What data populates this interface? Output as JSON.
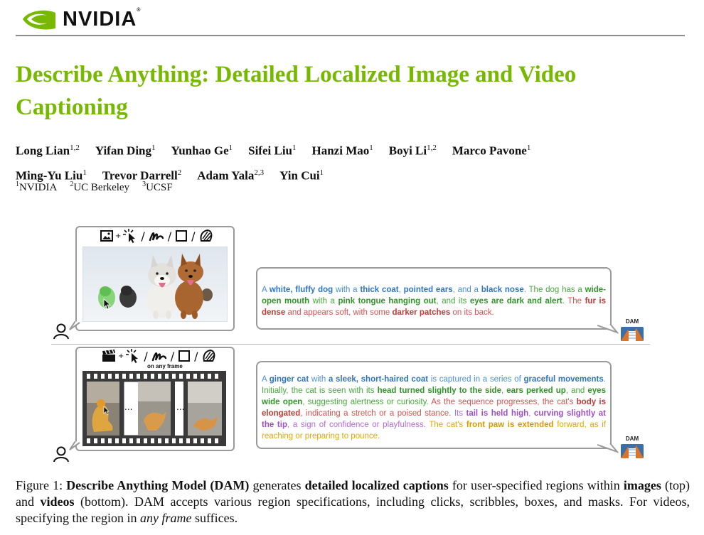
{
  "header": {
    "logo_text": "NVIDIA",
    "logo_mark": "®",
    "brand_color": "#76b900"
  },
  "paper": {
    "title": "Describe Anything: Detailed Localized Image and Video Captioning",
    "authors": [
      {
        "name": "Long Lian",
        "aff": "1,2"
      },
      {
        "name": "Yifan Ding",
        "aff": "1"
      },
      {
        "name": "Yunhao Ge",
        "aff": "1"
      },
      {
        "name": "Sifei Liu",
        "aff": "1"
      },
      {
        "name": "Hanzi Mao",
        "aff": "1"
      },
      {
        "name": "Boyi Li",
        "aff": "1,2"
      },
      {
        "name": "Marco Pavone",
        "aff": "1"
      },
      {
        "name": "Ming-Yu Liu",
        "aff": "1"
      },
      {
        "name": "Trevor Darrell",
        "aff": "2"
      },
      {
        "name": "Adam Yala",
        "aff": "2,3"
      },
      {
        "name": "Yin Cui",
        "aff": "1"
      }
    ],
    "affiliations": [
      {
        "num": "1",
        "name": "NVIDIA"
      },
      {
        "num": "2",
        "name": "UC Berkeley"
      },
      {
        "num": "3",
        "name": "UCSF"
      }
    ]
  },
  "figure": {
    "tool_plus": "+",
    "tool_slash": "/",
    "on_any_frame": "on any frame",
    "ellipsis": "...",
    "dam_label": "DAM",
    "image_caption": [
      {
        "c": "blue",
        "t": "A "
      },
      {
        "c": "blue",
        "b": true,
        "t": "white, fluffy dog"
      },
      {
        "c": "blue",
        "t": " with a "
      },
      {
        "c": "blue",
        "b": true,
        "t": "thick coat"
      },
      {
        "c": "blue",
        "t": ", "
      },
      {
        "c": "blue",
        "b": true,
        "t": "pointed ears"
      },
      {
        "c": "blue",
        "t": ", and a "
      },
      {
        "c": "blue",
        "b": true,
        "t": "black nose"
      },
      {
        "c": "blue",
        "t": ". "
      },
      {
        "c": "green",
        "t": "The dog has a "
      },
      {
        "c": "green",
        "b": true,
        "t": "wide-open mouth"
      },
      {
        "c": "green",
        "t": " with a "
      },
      {
        "c": "green",
        "b": true,
        "t": "pink tongue hanging out"
      },
      {
        "c": "green",
        "t": ", and its "
      },
      {
        "c": "green",
        "b": true,
        "t": "eyes are dark and alert"
      },
      {
        "c": "green",
        "t": ". "
      },
      {
        "c": "red",
        "t": "The "
      },
      {
        "c": "red",
        "b": true,
        "t": "fur is dense"
      },
      {
        "c": "red",
        "t": " and appears soft, with some "
      },
      {
        "c": "red",
        "b": true,
        "t": "darker patches"
      },
      {
        "c": "red",
        "t": " on its back."
      }
    ],
    "video_caption": [
      {
        "c": "blue",
        "t": "A "
      },
      {
        "c": "blue",
        "b": true,
        "t": "ginger cat"
      },
      {
        "c": "blue",
        "t": " with "
      },
      {
        "c": "blue",
        "b": true,
        "t": "a sleek, short-haired coat"
      },
      {
        "c": "blue",
        "t": " is captured in a series of "
      },
      {
        "c": "blue",
        "b": true,
        "t": "graceful movements"
      },
      {
        "c": "blue",
        "t": ". "
      },
      {
        "c": "green",
        "t": "Initially, the cat is seen with its "
      },
      {
        "c": "green",
        "b": true,
        "t": "head turned slightly to the side"
      },
      {
        "c": "green",
        "t": ", "
      },
      {
        "c": "green",
        "b": true,
        "t": "ears perked up"
      },
      {
        "c": "green",
        "t": ", and "
      },
      {
        "c": "green",
        "b": true,
        "t": "eyes wide open"
      },
      {
        "c": "green",
        "t": ", suggesting alertness or curiosity. "
      },
      {
        "c": "red",
        "t": "As the sequence progresses, the cat's "
      },
      {
        "c": "red",
        "b": true,
        "t": "body is elongated"
      },
      {
        "c": "red",
        "t": ", indicating a stretch or a poised stance. "
      },
      {
        "c": "purple",
        "t": "Its "
      },
      {
        "c": "purple",
        "b": true,
        "t": "tail is held high"
      },
      {
        "c": "purple",
        "t": ", "
      },
      {
        "c": "purple",
        "b": true,
        "t": "curving slightly at the tip"
      },
      {
        "c": "purple",
        "t": ", a sign of confidence or playfulness. "
      },
      {
        "c": "yellow",
        "t": "The cat's "
      },
      {
        "c": "yellow",
        "b": true,
        "t": "front paw is extended"
      },
      {
        "c": "yellow",
        "t": " forward, as if reaching or preparing to pounce."
      }
    ],
    "icons": [
      "image-icon",
      "click-icon",
      "scribble-icon",
      "box-icon",
      "mask-icon",
      "video-clapper-icon",
      "user-icon",
      "dam-logo-icon"
    ],
    "caption": {
      "label": "Figure 1:",
      "parts": [
        {
          "b": true,
          "t": "Describe Anything Model (DAM)"
        },
        {
          "t": " generates "
        },
        {
          "b": true,
          "t": "detailed localized captions"
        },
        {
          "t": " for user-specified regions within "
        },
        {
          "b": true,
          "t": "images"
        },
        {
          "t": " (top) and "
        },
        {
          "b": true,
          "t": "videos"
        },
        {
          "t": " (bottom). DAM accepts various region specifications, including clicks, scribbles, boxes, and masks. For videos, specifying the region in "
        },
        {
          "i": true,
          "t": "any frame"
        },
        {
          "t": " suffices."
        }
      ]
    }
  }
}
